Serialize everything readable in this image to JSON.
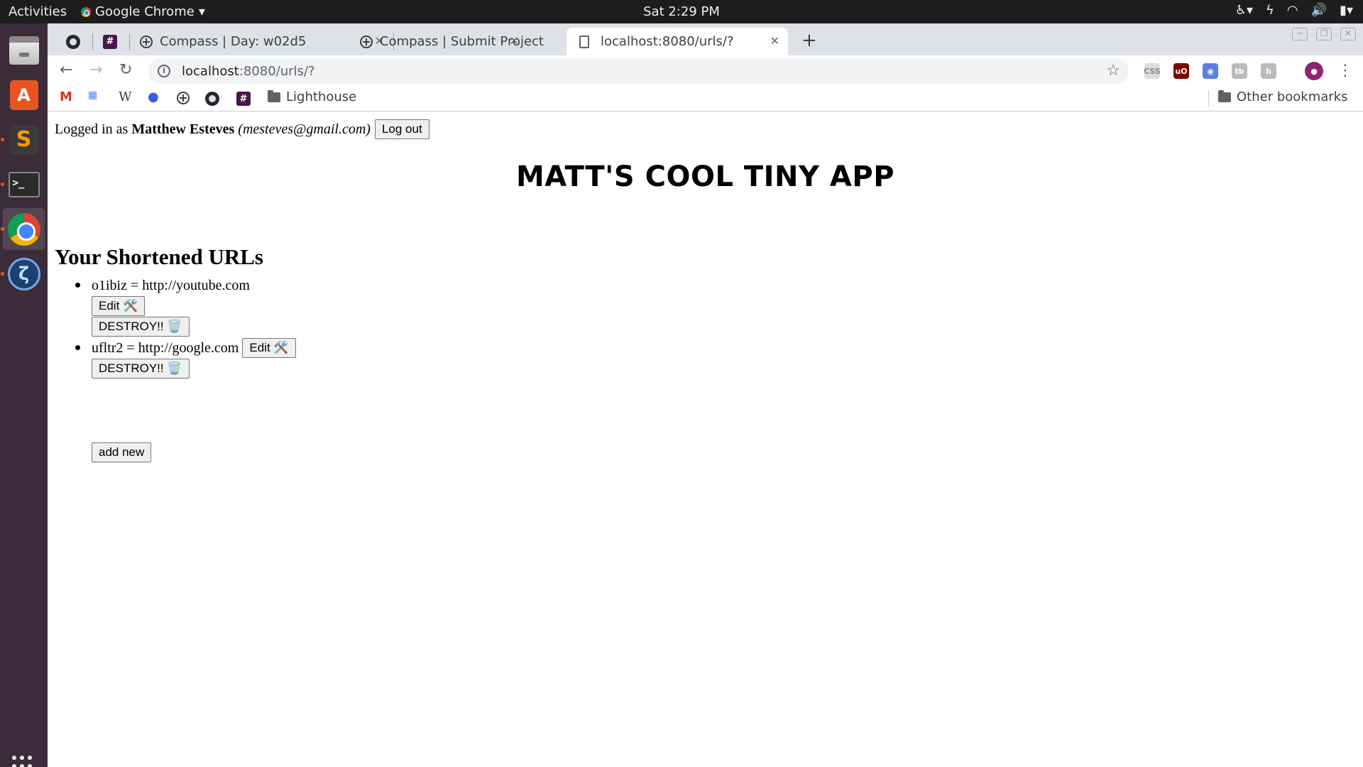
{
  "topbar": {
    "activities": "Activities",
    "app_name": "Google Chrome",
    "clock": "Sat  2:29 PM"
  },
  "tabs": [
    {
      "title": "Compass | Day: w02d5"
    },
    {
      "title": "Compass | Submit Project"
    },
    {
      "title": "localhost:8080/urls/?"
    }
  ],
  "omnibox": {
    "host": "localhost",
    "path": ":8080/urls/?"
  },
  "bookmarks": {
    "items": [
      "Lighthouse"
    ],
    "other": "Other bookmarks"
  },
  "page": {
    "login_prefix": "Logged in as",
    "user_name": "Matthew Esteves",
    "user_email": "(mesteves@gmail.com)",
    "logout_label": "Log out",
    "app_title": "MATT'S COOL TINY APP",
    "section_title": "Your Shortened URLs",
    "urls": [
      {
        "text": "o1ibiz = http://youtube.com",
        "edit": "Edit 🛠️",
        "destroy": "DESTROY!! 🗑️"
      },
      {
        "text": "ufltr2 = http://google.com",
        "edit": "Edit 🛠️",
        "destroy": "DESTROY!! 🗑️"
      }
    ],
    "add_new_label": "add new"
  }
}
